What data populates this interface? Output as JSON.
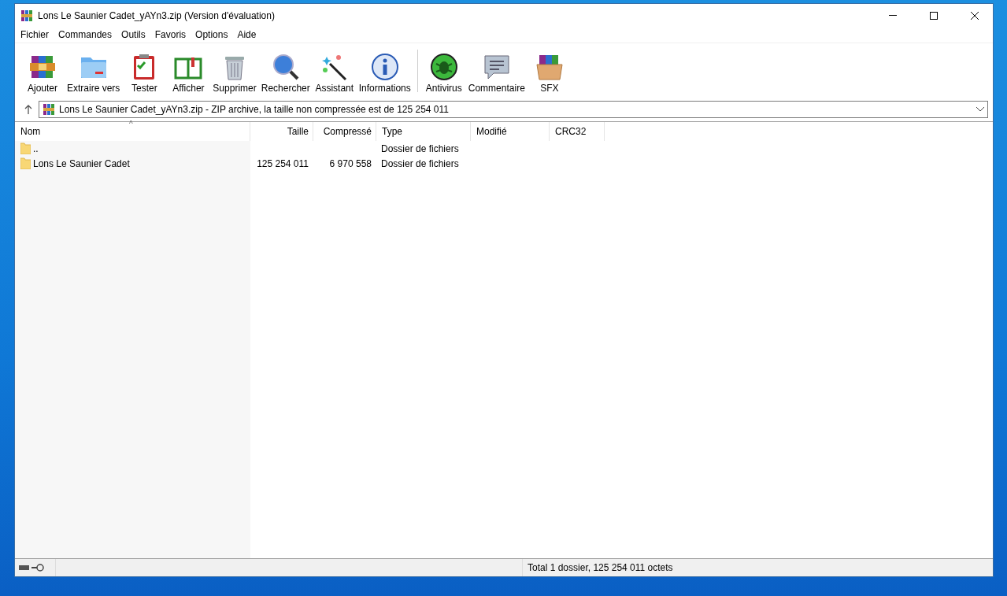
{
  "window": {
    "title": "Lons Le Saunier Cadet_yAYn3.zip (Version d'évaluation)"
  },
  "menu": [
    "Fichier",
    "Commandes",
    "Outils",
    "Favoris",
    "Options",
    "Aide"
  ],
  "toolbar": [
    {
      "kind": "add",
      "label": "Ajouter"
    },
    {
      "kind": "extract",
      "label": "Extraire vers"
    },
    {
      "kind": "test",
      "label": "Tester"
    },
    {
      "kind": "view",
      "label": "Afficher"
    },
    {
      "kind": "delete",
      "label": "Supprimer"
    },
    {
      "kind": "find",
      "label": "Rechercher"
    },
    {
      "kind": "wizard",
      "label": "Assistant"
    },
    {
      "kind": "info",
      "label": "Informations"
    },
    {
      "kind": "separator"
    },
    {
      "kind": "virus",
      "label": "Antivirus"
    },
    {
      "kind": "comment",
      "label": "Commentaire"
    },
    {
      "kind": "sfx",
      "label": "SFX"
    }
  ],
  "address": {
    "value": "Lons Le Saunier Cadet_yAYn3.zip - ZIP archive, la taille non compressée est de 125 254 011"
  },
  "table": {
    "sort_marker": "^",
    "columns": [
      "Nom",
      "Taille",
      "Compressé",
      "Type",
      "Modifié",
      "CRC32"
    ],
    "rows": [
      {
        "name": "..",
        "size": "",
        "packed": "",
        "type": "Dossier de fichiers"
      },
      {
        "name": "Lons Le Saunier Cadet",
        "size": "125 254 011",
        "packed": "6 970 558",
        "type": "Dossier de fichiers"
      }
    ]
  },
  "status_bar": {
    "text": "Total 1 dossier, 125 254 011 octets"
  }
}
